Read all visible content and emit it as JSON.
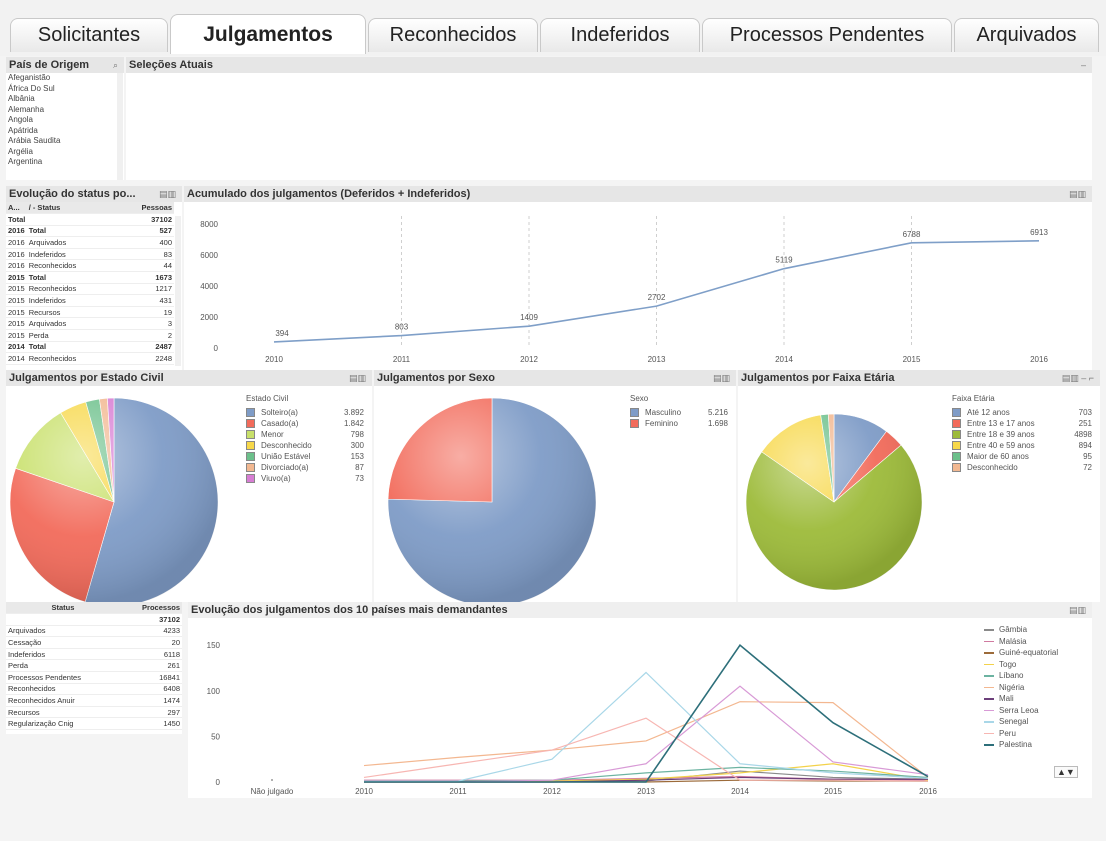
{
  "tabs": [
    {
      "label": "Solicitantes"
    },
    {
      "label": "Julgamentos"
    },
    {
      "label": "Reconhecidos"
    },
    {
      "label": "Indeferidos"
    },
    {
      "label": "Processos Pendentes"
    },
    {
      "label": "Arquivados"
    }
  ],
  "country_list": {
    "title": "País de Origem",
    "items": [
      "Afeganistão",
      "África Do Sul",
      "Albânia",
      "Alemanha",
      "Angola",
      "Apátrida",
      "Arábia Saudita",
      "Argélia",
      "Argentina"
    ]
  },
  "current_selections": {
    "title": "Seleções Atuais",
    "minimize": "–"
  },
  "status_evolution": {
    "title": "Evolução do status po...",
    "headers": [
      "A...",
      "/ - Status",
      "Pessoas"
    ],
    "total_label": "Total",
    "total_value": "37102",
    "rows": [
      {
        "year": "2016",
        "status": "Total",
        "value": "527",
        "bold": true
      },
      {
        "year": "2016",
        "status": "Arquivados",
        "value": "400"
      },
      {
        "year": "2016",
        "status": "Indeferidos",
        "value": "83"
      },
      {
        "year": "2016",
        "status": "Reconhecidos",
        "value": "44"
      },
      {
        "year": "2015",
        "status": "Total",
        "value": "1673",
        "bold": true
      },
      {
        "year": "2015",
        "status": "Reconhecidos",
        "value": "1217"
      },
      {
        "year": "2015",
        "status": "Indeferidos",
        "value": "431"
      },
      {
        "year": "2015",
        "status": "Recursos",
        "value": "19"
      },
      {
        "year": "2015",
        "status": "Arquivados",
        "value": "3"
      },
      {
        "year": "2015",
        "status": "Perda",
        "value": "2"
      },
      {
        "year": "2014",
        "status": "Total",
        "value": "2487",
        "bold": true
      },
      {
        "year": "2014",
        "status": "Reconhecidos",
        "value": "2248"
      }
    ]
  },
  "accumulated": {
    "title": "Acumulado dos julgamentos (Deferidos + Indeferidos)"
  },
  "civil": {
    "title": "Julgamentos por Estado Civil",
    "legend_title": "Estado Civil"
  },
  "sex": {
    "title": "Julgamentos por Sexo",
    "legend_title": "Sexo"
  },
  "age": {
    "title": "Julgamentos por Faixa Etária",
    "legend_title": "Faixa Etária"
  },
  "status_summary": {
    "headers": [
      "Status",
      "Processos"
    ],
    "total": "37102",
    "rows": [
      {
        "status": "Arquivados",
        "value": "4233"
      },
      {
        "status": "Cessação",
        "value": "20"
      },
      {
        "status": "Indeferidos",
        "value": "6118"
      },
      {
        "status": "Perda",
        "value": "261"
      },
      {
        "status": "Processos Pendentes",
        "value": "16841"
      },
      {
        "status": "Reconhecidos",
        "value": "6408"
      },
      {
        "status": "Reconhecidos Anuir",
        "value": "1474"
      },
      {
        "status": "Recursos",
        "value": "297"
      },
      {
        "status": "Regularização Cnig",
        "value": "1450"
      }
    ]
  },
  "top10": {
    "title": "Evolução dos julgamentos dos 10 países mais demandantes",
    "scroll_arrows": "▲▼"
  },
  "chart_data": [
    {
      "type": "line",
      "id": "accumulated",
      "x": [
        "2010",
        "2011",
        "2012",
        "2013",
        "2014",
        "2015",
        "2016"
      ],
      "values": [
        394,
        803,
        1409,
        2702,
        5119,
        6788,
        6913
      ],
      "data_labels": [
        "394",
        "803",
        "1409",
        "2702",
        "5119",
        "6788",
        "6913"
      ],
      "yticks": [
        "0",
        "2000",
        "4000",
        "6000",
        "8000"
      ],
      "ylim": [
        0,
        8000
      ],
      "color": "#7f9fc8"
    },
    {
      "type": "pie",
      "id": "civil",
      "labels": [
        "Solteiro(a)",
        "Casado(a)",
        "Menor",
        "Desconhecido",
        "União Estável",
        "Divorciado(a)",
        "Viuvo(a)"
      ],
      "values": [
        3892,
        1842,
        798,
        300,
        153,
        87,
        73
      ],
      "value_labels": [
        "3.892",
        "1.842",
        "798",
        "300",
        "153",
        "87",
        "73"
      ],
      "colors": [
        "#7f9cc7",
        "#f26b5b",
        "#c8e06a",
        "#f7d84a",
        "#6cc08b",
        "#f2b891",
        "#d77dd3"
      ]
    },
    {
      "type": "pie",
      "id": "sex",
      "labels": [
        "Masculino",
        "Feminino"
      ],
      "values": [
        5216,
        1698
      ],
      "value_labels": [
        "5.216",
        "1.698"
      ],
      "colors": [
        "#7f9cc7",
        "#f26b5b"
      ]
    },
    {
      "type": "pie",
      "id": "age",
      "labels": [
        "Até 12 anos",
        "Entre 13 e 17 anos",
        "Entre 18 e 39 anos",
        "Entre 40 e 59 anos",
        "Maior de 60 anos",
        "Desconhecido"
      ],
      "values": [
        703,
        251,
        4898,
        894,
        95,
        72
      ],
      "value_labels": [
        "703",
        "251",
        "4898",
        "894",
        "95",
        "72"
      ],
      "colors": [
        "#7f9cc7",
        "#f26b5b",
        "#9dbb3a",
        "#f7d84a",
        "#6cc08b",
        "#f2b891"
      ]
    },
    {
      "type": "line",
      "id": "top10",
      "x": [
        "Não julgado",
        "2010",
        "2011",
        "2012",
        "2013",
        "2014",
        "2015",
        "2016"
      ],
      "yticks": [
        "0",
        "50",
        "100",
        "150"
      ],
      "ylim": [
        0,
        160
      ],
      "series": [
        {
          "name": "Gâmbia",
          "color": "#8a8a8a",
          "values": [
            null,
            0,
            0,
            0,
            1,
            12,
            5,
            3
          ]
        },
        {
          "name": "Malásia",
          "color": "#d07aa0",
          "values": [
            null,
            2,
            2,
            2,
            4,
            6,
            3,
            2
          ]
        },
        {
          "name": "Guiné-equatorial",
          "color": "#9c6b3a",
          "values": [
            null,
            0,
            0,
            0,
            0,
            2,
            1,
            1
          ]
        },
        {
          "name": "Togo",
          "color": "#f3d24a",
          "values": [
            null,
            0,
            0,
            1,
            3,
            10,
            20,
            2
          ]
        },
        {
          "name": "Líbano",
          "color": "#6cb3a1",
          "values": [
            null,
            1,
            1,
            2,
            10,
            16,
            12,
            5
          ]
        },
        {
          "name": "Nigéria",
          "color": "#f3b790",
          "values": [
            null,
            18,
            27,
            35,
            45,
            88,
            87,
            5
          ]
        },
        {
          "name": "Mali",
          "color": "#6c3f7a",
          "values": [
            null,
            0,
            0,
            0,
            2,
            5,
            3,
            3
          ]
        },
        {
          "name": "Serra Leoa",
          "color": "#d89ad6",
          "values": [
            null,
            0,
            0,
            2,
            20,
            105,
            22,
            8
          ]
        },
        {
          "name": "Senegal",
          "color": "#a9d7e8",
          "values": [
            null,
            1,
            1,
            25,
            120,
            20,
            10,
            4
          ]
        },
        {
          "name": "Peru",
          "color": "#f7b6b2",
          "values": [
            null,
            5,
            20,
            35,
            70,
            2,
            2,
            1
          ]
        },
        {
          "name": "Palestina",
          "color": "#2d6f7a",
          "values": [
            null,
            0,
            0,
            0,
            0,
            150,
            65,
            6
          ]
        }
      ]
    }
  ]
}
